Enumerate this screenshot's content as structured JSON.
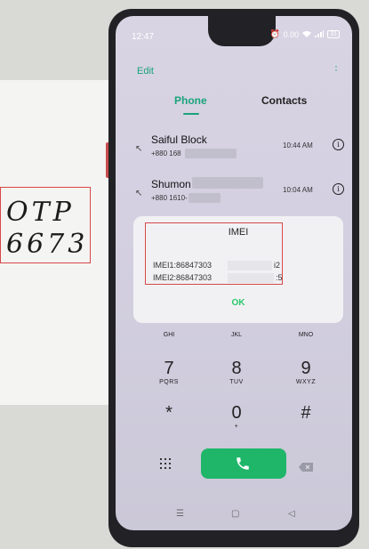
{
  "paper_note": {
    "line1": "OTP",
    "line2": "6673"
  },
  "status_bar": {
    "time": "12:47",
    "battery": "31",
    "net_speed": "0.00"
  },
  "toolbar": {
    "edit_label": "Edit"
  },
  "tabs": [
    {
      "label": "Phone",
      "active": true
    },
    {
      "label": "Contacts",
      "active": false
    }
  ],
  "recent_calls": [
    {
      "name": "Saiful Block",
      "number": "+880 168",
      "time": "10:44 AM"
    },
    {
      "name": "Shumon",
      "number": "+880 1610-",
      "time": "10:04 AM"
    }
  ],
  "dialog": {
    "title": "IMEI",
    "imei1_prefix": "IMEI1:86847303",
    "imei1_suffix": "i2",
    "imei2_prefix": "IMEI2:86847303",
    "imei2_suffix": ":5",
    "ok_label": "OK"
  },
  "keypad": {
    "partial_row": [
      "GHI",
      "JKL",
      "MNO"
    ],
    "rows": [
      [
        {
          "digit": "7",
          "letters": "PQRS"
        },
        {
          "digit": "8",
          "letters": "TUV"
        },
        {
          "digit": "9",
          "letters": "WXYZ"
        }
      ],
      [
        {
          "digit": "*",
          "letters": ""
        },
        {
          "digit": "0",
          "letters": "+"
        },
        {
          "digit": "#",
          "letters": ""
        }
      ]
    ]
  },
  "colors": {
    "accent": "#1aa37a",
    "call_button": "#20b66a",
    "highlight": "#d84848"
  },
  "icons": [
    "wifi-icon",
    "signal-icon",
    "alarm-icon",
    "info-icon",
    "phone-icon",
    "dialpad-icon",
    "backspace-icon",
    "menu-icon",
    "home-icon",
    "back-icon"
  ]
}
